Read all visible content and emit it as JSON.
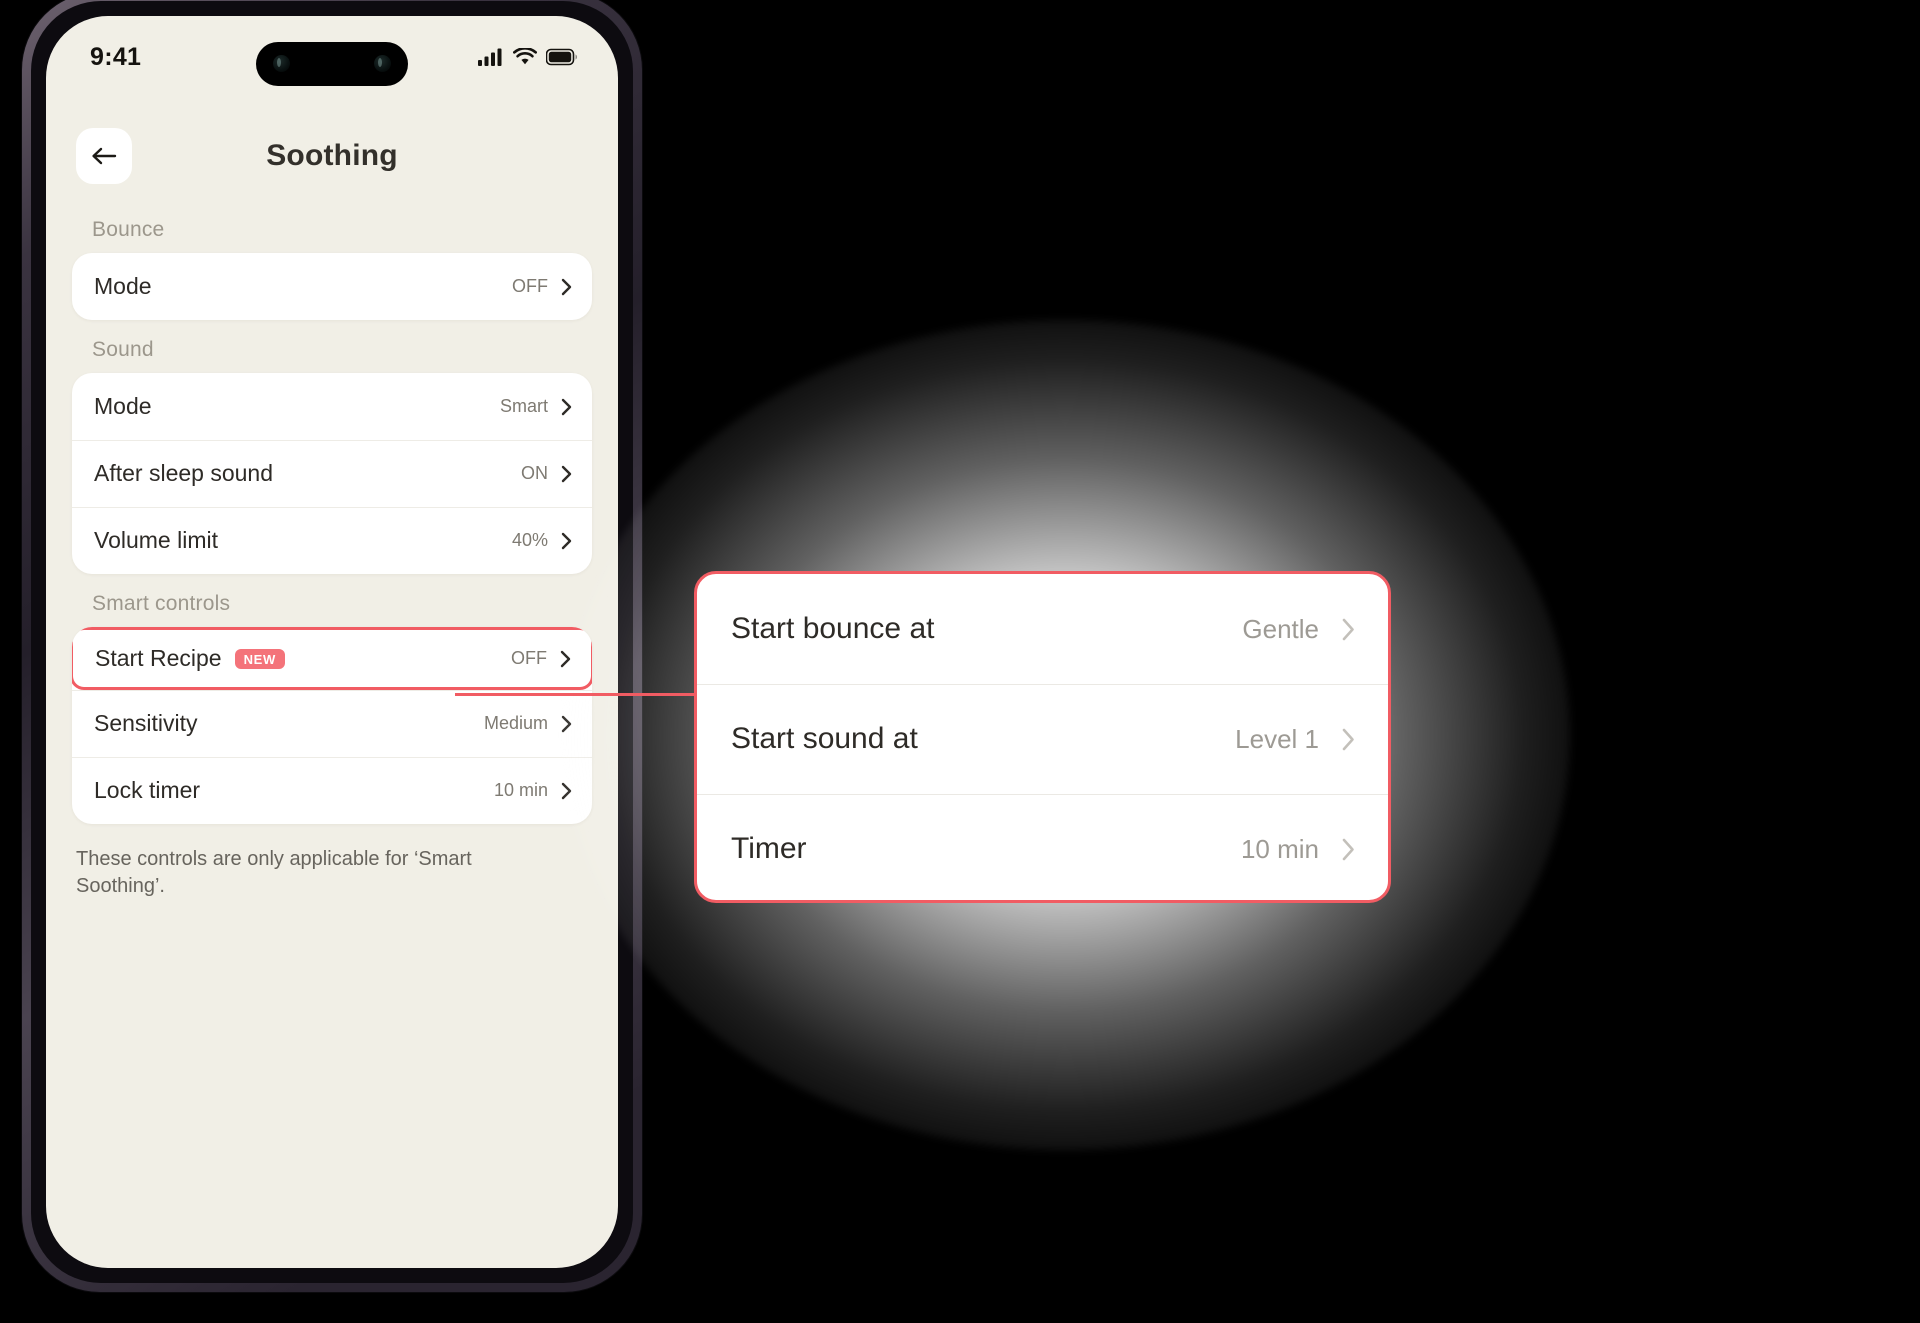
{
  "statusbar": {
    "time": "9:41",
    "cellular_icon": "cellular-signal-icon",
    "wifi_icon": "wifi-icon",
    "battery_icon": "battery-icon"
  },
  "header": {
    "title": "Soothing",
    "back_icon": "back-arrow-icon"
  },
  "sections": [
    {
      "label": "Bounce",
      "rows": [
        {
          "label": "Mode",
          "value": "OFF"
        }
      ]
    },
    {
      "label": "Sound",
      "rows": [
        {
          "label": "Mode",
          "value": "Smart"
        },
        {
          "label": "After sleep sound",
          "value": "ON"
        },
        {
          "label": "Volume limit",
          "value": "40%"
        }
      ]
    },
    {
      "label": "Smart controls",
      "rows": [
        {
          "label": "Start Recipe",
          "value": "OFF",
          "badge": "NEW"
        },
        {
          "label": "Sensitivity",
          "value": "Medium"
        },
        {
          "label": "Lock timer",
          "value": "10 min"
        }
      ]
    }
  ],
  "footer_note": "These controls are only applicable for ‘Smart Soothing’.",
  "callout": {
    "rows": [
      {
        "label": "Start bounce at",
        "value": "Gentle"
      },
      {
        "label": "Start sound at",
        "value": "Level 1"
      },
      {
        "label": "Timer",
        "value": "10 min"
      }
    ]
  },
  "colors": {
    "accent": "#f15c63",
    "badge": "#f4737a",
    "screen_bg": "#f1efe6",
    "card_bg": "#ffffff"
  }
}
